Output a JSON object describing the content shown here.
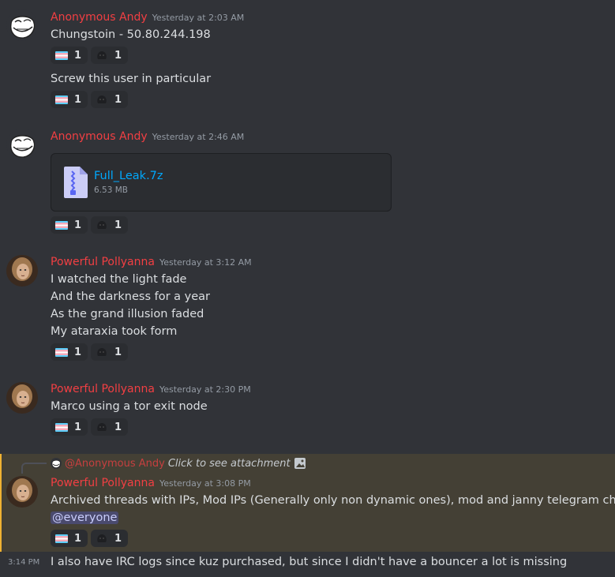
{
  "colors": {
    "background": "#313338",
    "author": "#f23f43",
    "timestamp": "#949ba4",
    "link": "#00a8fc",
    "highlight_bg": "#444035"
  },
  "messages": [
    {
      "author": "Anonymous Andy",
      "timestamp": "Yesterday at 2:03 AM",
      "avatar_icon": "trollface-icon",
      "lines": [
        "Chungstoin - 50.80.244.198"
      ],
      "reactions": [
        {
          "emoji": "trans-flag-icon",
          "count": "1"
        },
        {
          "emoji": "black-blob-icon",
          "count": "1"
        }
      ],
      "followup": {
        "lines": [
          "Screw this user in particular"
        ],
        "reactions": [
          {
            "emoji": "trans-flag-icon",
            "count": "1"
          },
          {
            "emoji": "black-blob-icon",
            "count": "1"
          }
        ]
      }
    },
    {
      "author": "Anonymous Andy",
      "timestamp": "Yesterday at 2:46 AM",
      "avatar_icon": "trollface-icon",
      "attachment": {
        "name": "Full_Leak.7z",
        "size": "6.53 MB",
        "icon": "zip-file-icon"
      },
      "reactions": [
        {
          "emoji": "trans-flag-icon",
          "count": "1"
        },
        {
          "emoji": "black-blob-icon",
          "count": "1"
        }
      ]
    },
    {
      "author": "Powerful Pollyanna",
      "timestamp": "Yesterday at 3:12 AM",
      "avatar_icon": "portrait-avatar-icon",
      "lines": [
        "I watched the light fade",
        "And the darkness for a year",
        "As the grand illusion faded",
        "My ataraxia took form"
      ],
      "reactions": [
        {
          "emoji": "trans-flag-icon",
          "count": "1"
        },
        {
          "emoji": "black-blob-icon",
          "count": "1"
        }
      ]
    },
    {
      "author": "Powerful Pollyanna",
      "timestamp": "Yesterday at 2:30 PM",
      "avatar_icon": "portrait-avatar-icon",
      "lines": [
        "Marco using a tor exit node"
      ],
      "reactions": [
        {
          "emoji": "trans-flag-icon",
          "count": "1"
        },
        {
          "emoji": "black-blob-icon",
          "count": "1"
        }
      ]
    },
    {
      "reply": {
        "mention": "@Anonymous Andy",
        "text": "Click to see attachment",
        "icon": "image-icon"
      },
      "author": "Powerful Pollyanna",
      "timestamp": "Yesterday at 3:08 PM",
      "avatar_icon": "portrait-avatar-icon",
      "lines": [
        "Archived threads with IPs, Mod IPs (Generally only non dynamic ones), mod and janny telegram chats"
      ],
      "mention": "@everyone",
      "reactions": [
        {
          "emoji": "trans-flag-icon",
          "count": "1"
        },
        {
          "emoji": "black-blob-icon",
          "count": "1"
        }
      ]
    },
    {
      "side_timestamp": "3:14 PM",
      "lines": [
        "I also have IRC logs since kuz purchased, but since I didn't have a bouncer a lot is missing"
      ]
    }
  ]
}
